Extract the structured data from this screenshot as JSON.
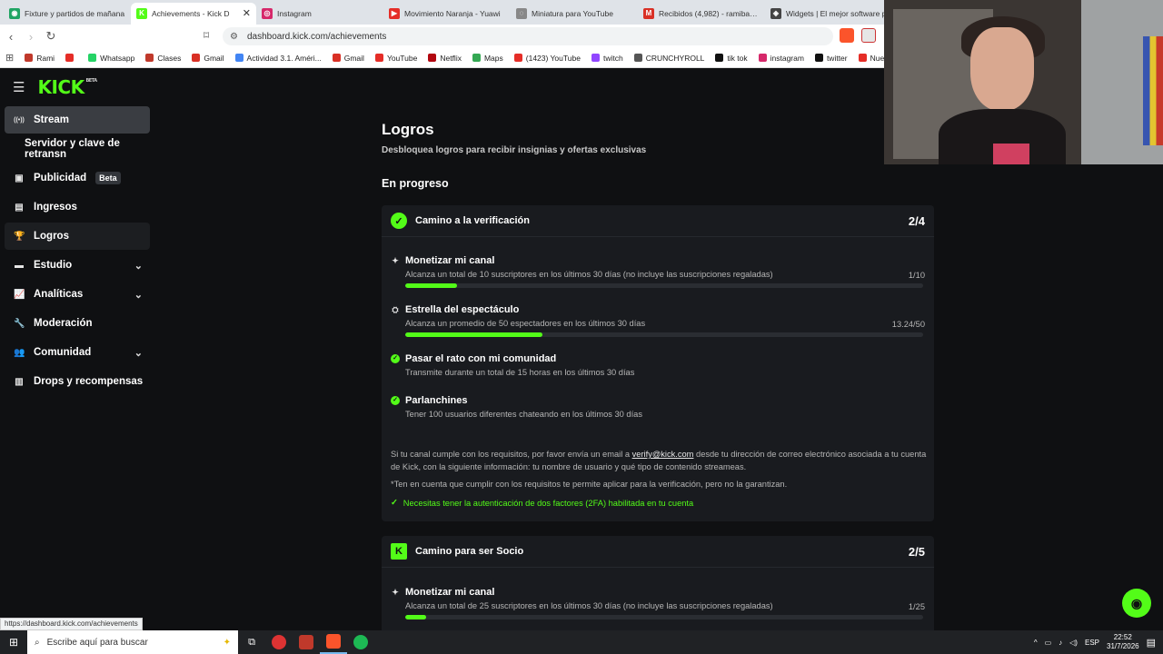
{
  "browser": {
    "tabs": [
      {
        "label": "Fixture y partidos de mañana",
        "color": "#1fa463",
        "glyph": "◉"
      },
      {
        "label": "Achievements - Kick D",
        "color": "#53fc18",
        "glyph": "K",
        "active": true
      },
      {
        "label": "Instagram",
        "color": "#d6286a",
        "glyph": "◎"
      },
      {
        "label": "Movimiento Naranja - Yuawi",
        "color": "#e52d27",
        "glyph": "▶"
      },
      {
        "label": "Miniatura para YouTube",
        "color": "#888888",
        "glyph": "◌"
      },
      {
        "label": "Recibidos (4,982) - ramibargn",
        "color": "#d93025",
        "glyph": "M"
      },
      {
        "label": "Widgets | El mejor software p",
        "color": "#444444",
        "glyph": "◈"
      }
    ],
    "url": "dashboard.kick.com/achievements",
    "bookmarks": [
      {
        "label": "Rami",
        "color": "#c0392b"
      },
      {
        "label": "",
        "color": "#e52d27"
      },
      {
        "label": "Whatsapp",
        "color": "#25d366"
      },
      {
        "label": "Clases",
        "color": "#c0392b"
      },
      {
        "label": "Gmail",
        "color": "#d93025"
      },
      {
        "label": "Actividad 3.1. Améri...",
        "color": "#4285f4"
      },
      {
        "label": "Gmail",
        "color": "#d93025"
      },
      {
        "label": "YouTube",
        "color": "#e52d27"
      },
      {
        "label": "Netflix",
        "color": "#b20710"
      },
      {
        "label": "Maps",
        "color": "#34a853"
      },
      {
        "label": "(1423) YouTube",
        "color": "#e52d27"
      },
      {
        "label": "twitch",
        "color": "#9146ff"
      },
      {
        "label": "CRUNCHYROLL",
        "color": "#555555"
      },
      {
        "label": "tik tok",
        "color": "#111111"
      },
      {
        "label": "instagram",
        "color": "#d6286a"
      },
      {
        "label": "twitter",
        "color": "#111111"
      },
      {
        "label": "Nueva victi",
        "color": "#e52d27"
      }
    ],
    "status_url": "https://dashboard.kick.com/achievements"
  },
  "sidebar": {
    "logo": "KICK",
    "logo_tag": "BETA",
    "items": [
      {
        "label": "Stream",
        "icon": "broadcast-icon",
        "glyph": "((•))"
      },
      {
        "label": "Servidor y clave de retransn",
        "icon": "",
        "glyph": ""
      },
      {
        "label": "Publicidad",
        "icon": "ad-icon",
        "glyph": "▣",
        "badge": "Beta"
      },
      {
        "label": "Ingresos",
        "icon": "revenue-icon",
        "glyph": "▤"
      },
      {
        "label": "Logros",
        "icon": "trophy-icon",
        "glyph": "🏆"
      },
      {
        "label": "Estudio",
        "icon": "studio-icon",
        "glyph": "▬"
      },
      {
        "label": "Analíticas",
        "icon": "analytics-icon",
        "glyph": "📈"
      },
      {
        "label": "Moderación",
        "icon": "wrench-icon",
        "glyph": "🔧"
      },
      {
        "label": "Comunidad",
        "icon": "community-icon",
        "glyph": "👥"
      },
      {
        "label": "Drops y recompensas",
        "icon": "drops-icon",
        "glyph": "▥"
      }
    ]
  },
  "main": {
    "title": "Logros",
    "subtitle": "Desbloquea logros para recibir insignias y ofertas exclusivas",
    "section_label": "En progreso",
    "verification": {
      "title": "Camino a la verificación",
      "count": "2/4",
      "tasks": [
        {
          "title": "Monetizar mi canal",
          "desc": "Alcanza un total de 10 suscriptores en los últimos 30 días (no incluye las suscripciones regaladas)",
          "progress_text": "1/10",
          "progress": 0.1,
          "done": false,
          "glyph": "✦"
        },
        {
          "title": "Estrella del espectáculo",
          "desc": "Alcanza un promedio de 50 espectadores en los últimos 30 días",
          "progress_text": "13.24/50",
          "progress": 0.2648,
          "done": false,
          "glyph": "⛭"
        },
        {
          "title": "Pasar el rato con mi comunidad",
          "desc": "Transmite durante un total de 15 horas en los últimos 30 días",
          "progress_text": "",
          "progress": 1,
          "done": true,
          "glyph": "✓"
        },
        {
          "title": "Parlanchines",
          "desc": "Tener 100 usuarios diferentes chateando en los últimos 30 días",
          "progress_text": "",
          "progress": 1,
          "done": true,
          "glyph": "✓"
        }
      ],
      "note_part1": "Si tu canal cumple con los requisitos, por favor envía un email a ",
      "note_email": "verify@kick.com",
      "note_part2": " desde tu dirección de correo electrónico asociada a tu cuenta de Kick, con la siguiente información: tu nombre de usuario y qué tipo de contenido streameas.",
      "note_disclaimer": "*Ten en cuenta que cumplir con los requisitos te permite aplicar para la verificación, pero no la garantizan.",
      "note_2fa": "Necesitas tener la autenticación de dos factores (2FA) habilitada en tu cuenta"
    },
    "partner": {
      "title": "Camino para ser Socio",
      "count": "2/5",
      "tasks": [
        {
          "title": "Monetizar mi canal",
          "desc": "Alcanza un total de 25 suscriptores en los últimos 30 días (no incluye las suscripciones regaladas)",
          "progress_text": "1/25",
          "progress": 0.04,
          "done": false,
          "glyph": "✦"
        }
      ]
    }
  },
  "taskbar": {
    "search_placeholder": "Escribe aquí para buscar",
    "lang": "ESP",
    "time": "22:52",
    "date": "31/7/2026"
  },
  "colors": {
    "accent": "#53fc18",
    "background": "#0f1012",
    "card": "#191b1f"
  }
}
